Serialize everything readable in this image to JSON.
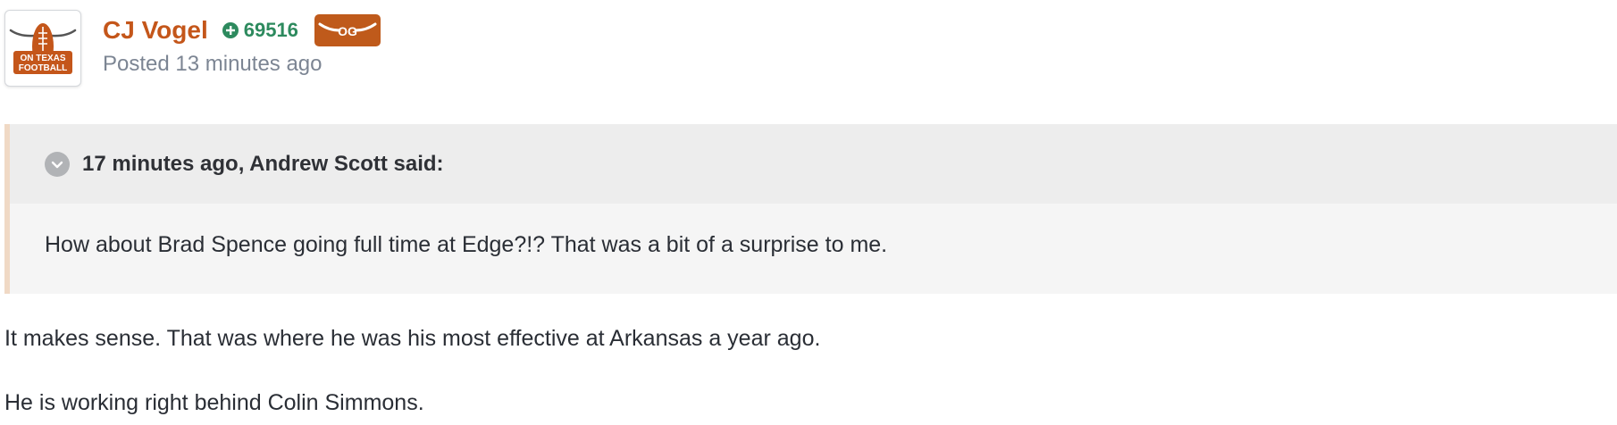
{
  "author": {
    "name": "CJ Vogel",
    "reputation": "69516",
    "badge_text": "OG",
    "avatar_text_line1": "ON TEXAS",
    "avatar_text_line2": "FOOTBALL"
  },
  "post_meta": {
    "posted_label": "Posted",
    "time_ago": "13 minutes ago"
  },
  "quote": {
    "header": "17 minutes ago, Andrew Scott said:",
    "text": "How about Brad Spence going full time at Edge?!? That was a bit of a surprise to me."
  },
  "body": {
    "paragraphs": [
      "It makes sense. That was where he was his most effective at Arkansas a year ago.",
      "He is working right behind Colin Simmons."
    ]
  },
  "colors": {
    "author_name": "#c4561a",
    "reputation": "#2d8a5e",
    "badge_bg": "#bf5a1b",
    "quote_border": "#f0d9c5"
  },
  "icons": {
    "avatar": "on-texas-football-logo",
    "reputation": "plus-circle-icon",
    "quote_toggle": "chevron-down-icon"
  }
}
